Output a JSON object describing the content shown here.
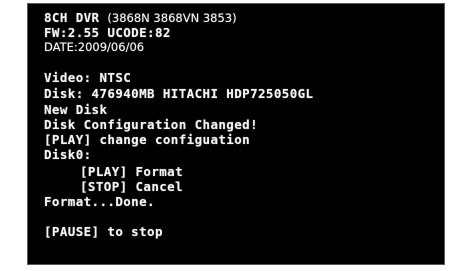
{
  "screen": {
    "background": "#000000",
    "text_color": "#f4f4f4",
    "header": {
      "model": "8CH DVR",
      "model_variants": "(3868N 3868VN 3853)",
      "firmware": "FW:2.55 UCODE:82",
      "date": "DATE:2009/06/06"
    },
    "info": {
      "video": "Video: NTSC",
      "disk": "Disk: 476940MB HITACHI HDP725050GL"
    },
    "messages": {
      "new_disk": "New Disk",
      "config_changed": "Disk Configuration Changed!",
      "change_config": "[PLAY] change configuation",
      "disk0": "Disk0:",
      "format_option": "[PLAY] Format",
      "cancel_option": "[STOP] Cancel",
      "format_done": "Format...Done.",
      "stop_hint": "[PAUSE] to stop"
    }
  }
}
